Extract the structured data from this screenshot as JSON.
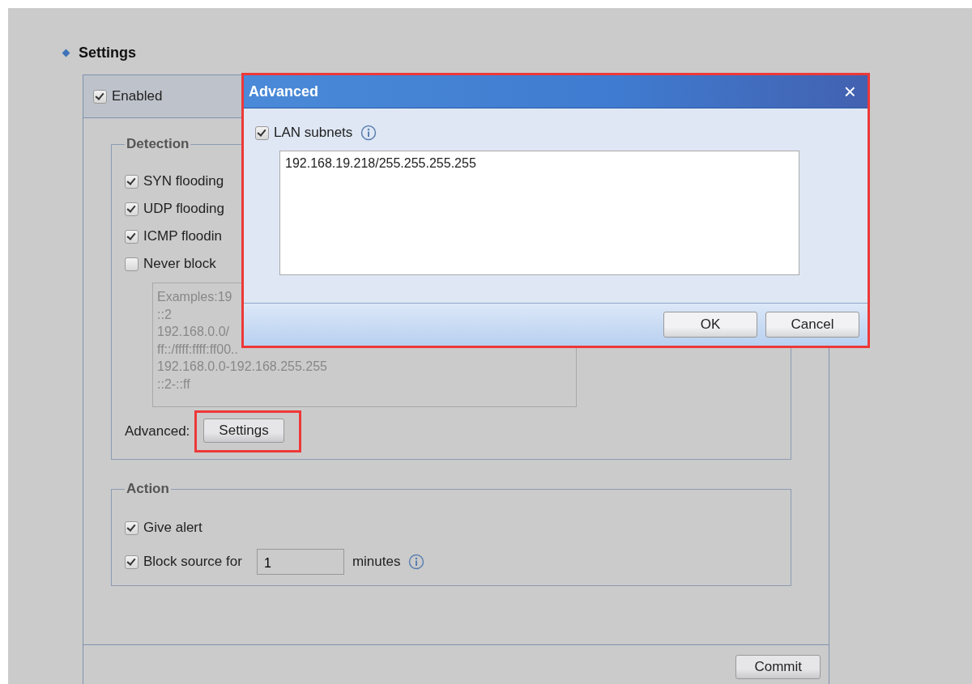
{
  "page": {
    "heading": "Settings"
  },
  "panel": {
    "enabled": {
      "label": "Enabled",
      "checked": true
    },
    "detection": {
      "legend": "Detection",
      "options": [
        {
          "label": "SYN flooding",
          "checked": true
        },
        {
          "label": "UDP flooding",
          "checked": true
        },
        {
          "label": "ICMP floodin",
          "checked": true
        },
        {
          "label": "Never block",
          "checked": false
        }
      ],
      "exceptions": {
        "placeholder": "Examples:19\n::2\n192.168.0.0/\nff::/ffff:ffff:ff00..\n192.168.0.0-192.168.255.255\n::2-::ff"
      },
      "advanced_label": "Advanced:",
      "advanced_button": {
        "label": "Settings",
        "highlighted": true
      }
    },
    "action": {
      "legend": "Action",
      "give_alert": {
        "label": "Give alert",
        "checked": true
      },
      "block_source": {
        "label": "Block source for",
        "checked": true,
        "value": "1",
        "unit": "minutes"
      }
    },
    "commit": "Commit"
  },
  "dialog": {
    "title": "Advanced",
    "close": "×",
    "highlighted": true,
    "lan_subnets": {
      "label": "LAN subnets",
      "checked": true
    },
    "subnets_value": "192.168.19.218/255.255.255.255",
    "buttons": [
      "OK",
      "Cancel"
    ]
  }
}
